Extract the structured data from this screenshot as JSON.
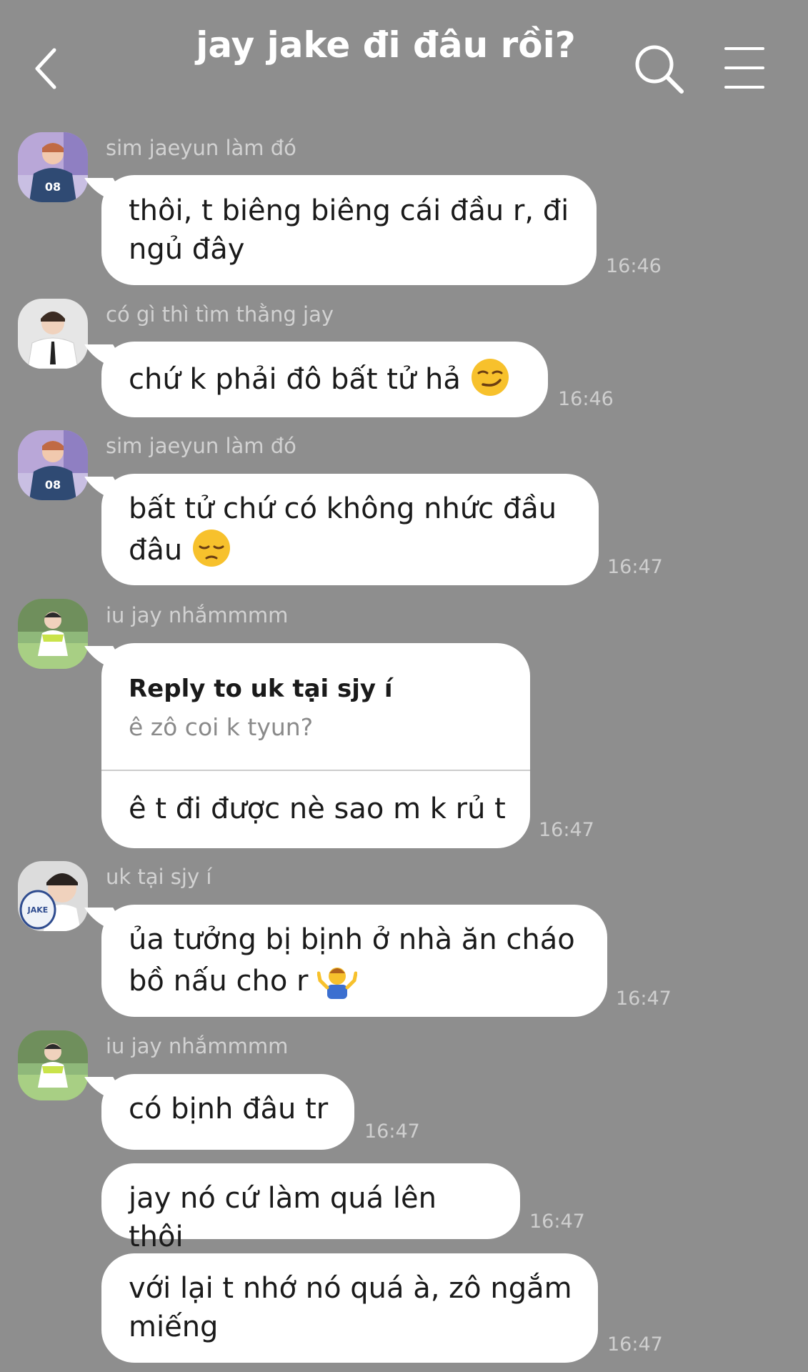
{
  "header": {
    "title": "jay jake đi đâu rồi?",
    "back_icon": "chevron-left-icon",
    "search_icon": "search-icon",
    "menu_icon": "hamburger-menu-icon"
  },
  "messages": [
    {
      "sender": "sim jaeyun làm đó",
      "text": "thôi, t biêng biêng cái đầu r, đi\nngủ đây",
      "time": "16:46"
    },
    {
      "sender": "có gì thì tìm thằng jay",
      "text": "chứ k phải đô bất tử hả ",
      "emoji": "smirking-face",
      "time": "16:46"
    },
    {
      "sender": "sim jaeyun làm đó",
      "text": "bất tử chứ có không nhức đầu\nđâu ",
      "emoji": "pensive-face",
      "time": "16:47"
    },
    {
      "sender": "iu jay nhắmmmm",
      "reply_to_label": "Reply to uk tại sjy í",
      "reply_quote": "ê zô coi k tyun?",
      "text": "ê t đi được nè sao m k rủ t",
      "time": "16:47"
    },
    {
      "sender": "uk tại sjy í",
      "text": "ủa tưởng bị bịnh ở nhà ăn cháo\nbồ nấu cho r ",
      "emoji": "person-shrugging",
      "time": "16:47"
    },
    {
      "sender": "iu jay nhắmmmm",
      "text": "có bịnh đâu tr",
      "time": "16:47"
    },
    {
      "text": "jay nó cứ làm quá lên thôi",
      "time": "16:47"
    },
    {
      "text": "với lại t nhớ nó quá à, zô ngắm\nmiếng",
      "time": "16:47"
    }
  ],
  "colors": {
    "background": "#8e8e8e",
    "bubble": "#ffffff",
    "sender_text": "#d2d2d2",
    "timestamp": "#cfcfcf"
  }
}
